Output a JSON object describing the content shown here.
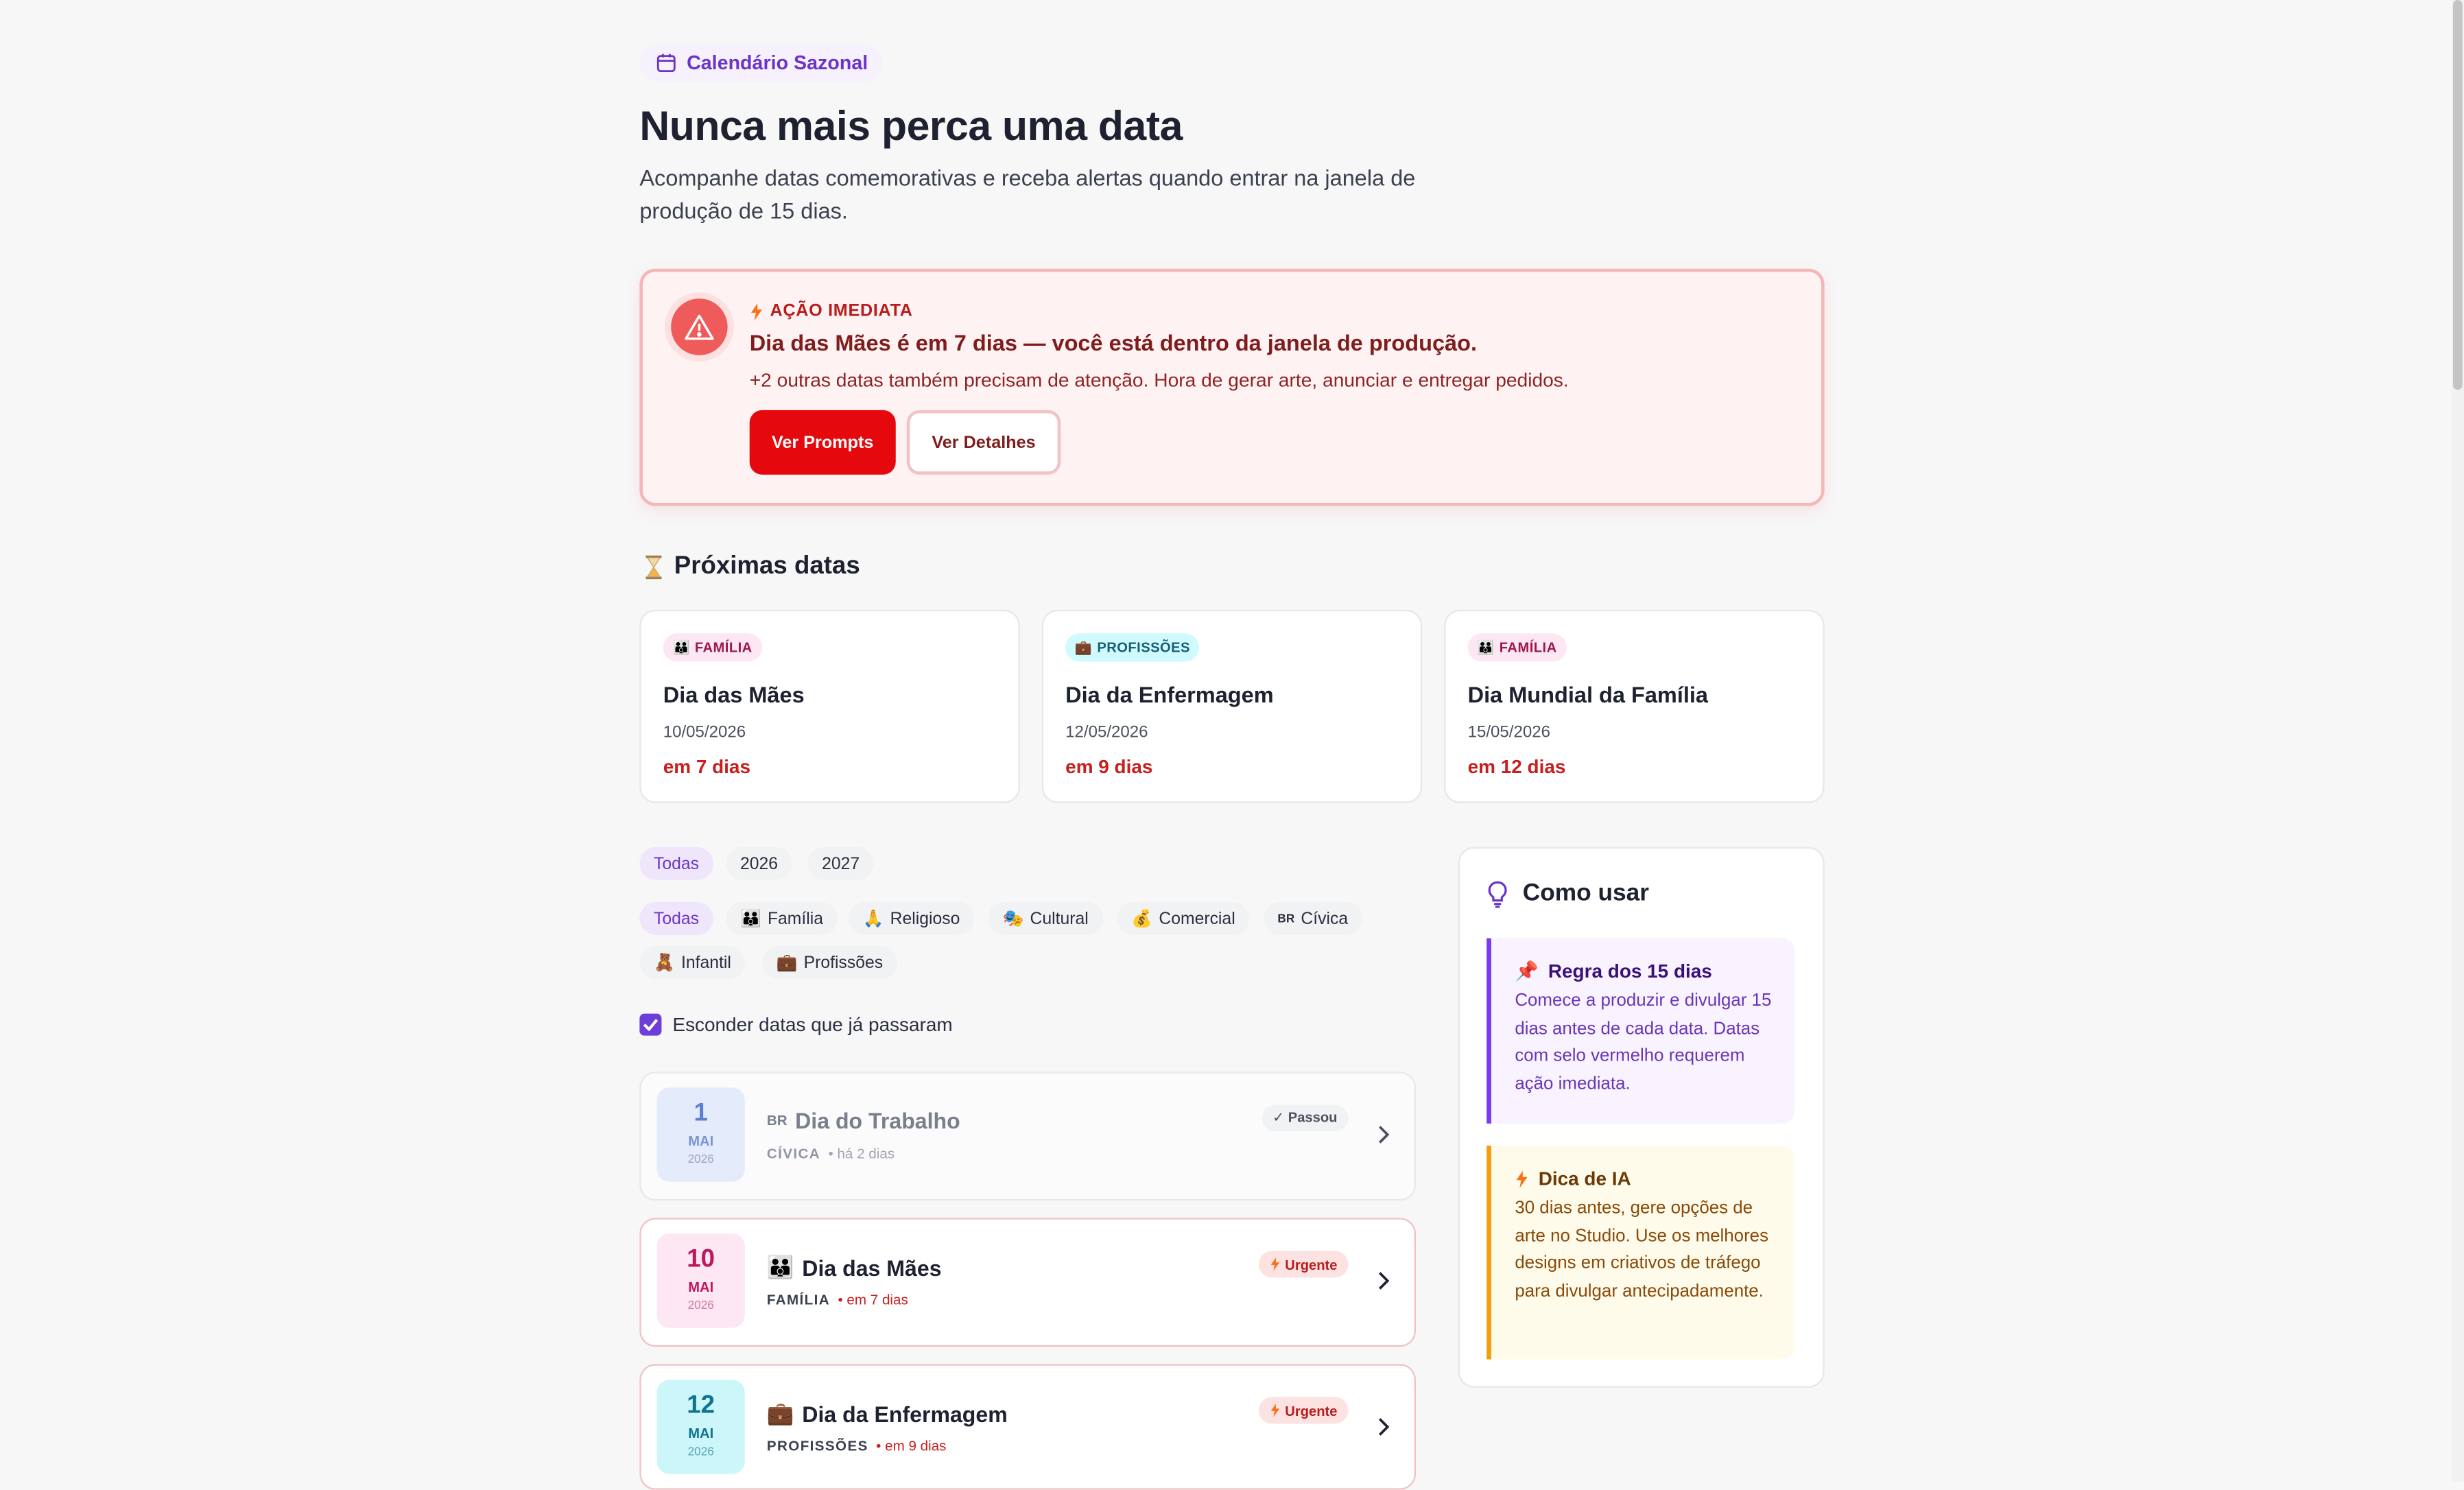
{
  "header": {
    "badge": "Calendário Sazonal",
    "title": "Nunca mais perca uma data",
    "subtitle": "Acompanhe datas comemorativas e receba alertas quando entrar na janela de produção de 15 dias."
  },
  "alert": {
    "kicker": "AÇÃO IMEDIATA",
    "headline_strong": "Dia das Mães",
    "headline_rest": " é em 7 dias — você está dentro da janela de produção.",
    "body": "+2 outras datas também precisam de atenção. Hora de gerar arte, anunciar e entregar pedidos.",
    "primary_button": "Ver Prompts",
    "secondary_button": "Ver Detalhes"
  },
  "upcoming": {
    "section_title": "Próximas datas",
    "cards": [
      {
        "category": "FAMÍLIA",
        "name": "Dia das Mães",
        "date": "10/05/2026",
        "in": "em 7 dias"
      },
      {
        "category": "PROFISSÕES",
        "name": "Dia da Enfermagem",
        "date": "12/05/2026",
        "in": "em 9 dias"
      },
      {
        "category": "FAMÍLIA",
        "name": "Dia Mundial da Família",
        "date": "15/05/2026",
        "in": "em 12 dias"
      }
    ]
  },
  "filters": {
    "years": [
      "Todas",
      "2026",
      "2027"
    ],
    "categories": [
      "Todas",
      "Família",
      "Religioso",
      "Cultural",
      "Comercial",
      "Cívica",
      "Infantil",
      "Profissões"
    ],
    "civica_prefix": "BR",
    "hide_past_label": "Esconder datas que já passaram"
  },
  "list": [
    {
      "day": "1",
      "month": "MAI",
      "year": "2026",
      "prefix": "BR",
      "title": "Dia do Trabalho",
      "category": "CÍVICA",
      "when": "• há 2 dias",
      "tag": "✓ Passou"
    },
    {
      "day": "10",
      "month": "MAI",
      "year": "2026",
      "title": "Dia das Mães",
      "category": "FAMÍLIA",
      "when": "• em 7 dias",
      "tag": "Urgente"
    },
    {
      "day": "12",
      "month": "MAI",
      "year": "2026",
      "title": "Dia da Enfermagem",
      "category": "PROFISSÕES",
      "when": "• em 9 dias",
      "tag": "Urgente"
    }
  ],
  "sidebar": {
    "title": "Como usar",
    "tips": [
      {
        "title": "Regra dos 15 dias",
        "text": "Comece a produzir e divulgar 15 dias antes de cada data. Datas com selo vermelho requerem ação imediata."
      },
      {
        "title": "Dica de IA",
        "text": "30 dias antes, gere opções de arte no Studio. Use os melhores designs em criativos de tráfego para divulgar antecipadamente."
      }
    ]
  },
  "colors": {
    "accent": "#6b34c9",
    "danger": "#e5080d",
    "alert_bg": "#fef2f2",
    "tip_purple": "#7c3aed",
    "tip_amber": "#f59e0b"
  }
}
